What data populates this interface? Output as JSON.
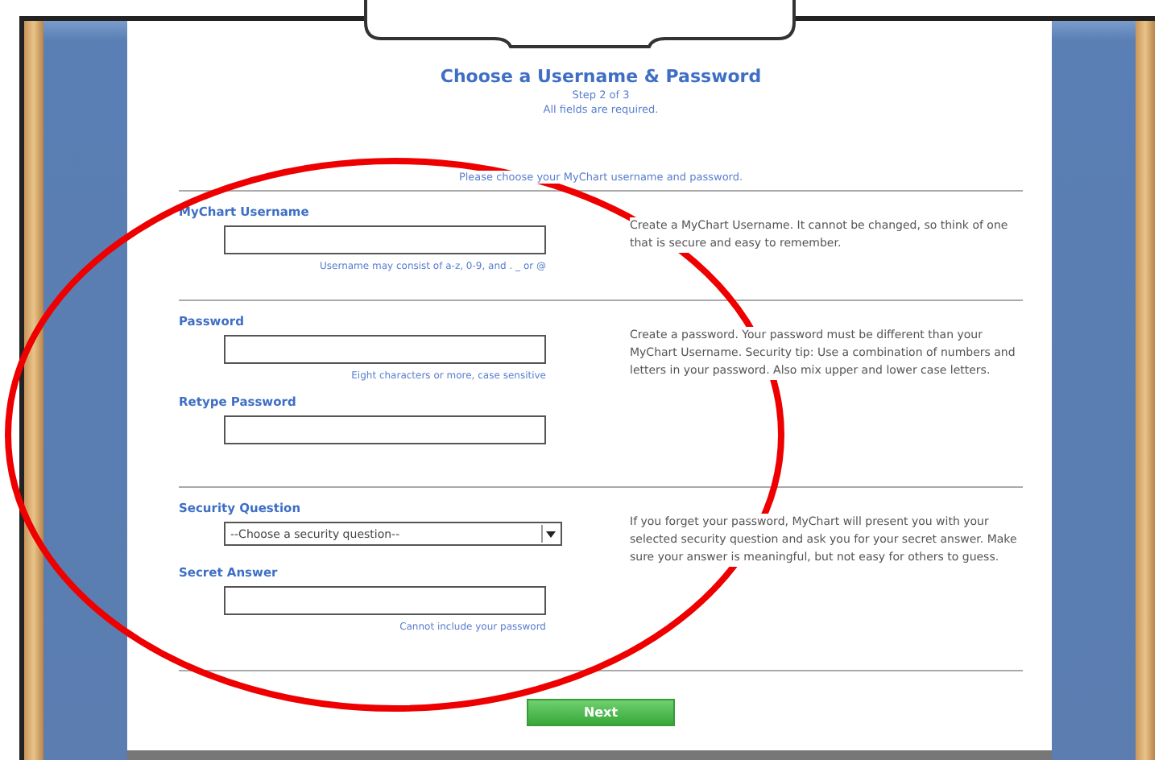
{
  "header": {
    "title": "Choose a Username & Password",
    "step": "Step 2 of 3",
    "required_note": "All fields are required."
  },
  "intro": "Please choose your MyChart username and password.",
  "sections": [
    {
      "fields": [
        {
          "label": "MyChart Username",
          "kind": "text",
          "hint": "Username may consist of a-z, 0-9, and . _ or @"
        }
      ],
      "description": "Create a MyChart Username. It cannot be changed, so think of one that is secure and easy to remember."
    },
    {
      "fields": [
        {
          "label": "Password",
          "kind": "text",
          "hint": "Eight characters or more, case sensitive"
        },
        {
          "label": "Retype Password",
          "kind": "text"
        }
      ],
      "description": "Create a password. Your password must be different than your MyChart Username. Security tip: Use a combination of numbers and letters in your password. Also mix upper and lower case letters."
    },
    {
      "fields": [
        {
          "label": "Security Question",
          "kind": "select",
          "value": "--Choose a security question--"
        },
        {
          "label": "Secret Answer",
          "kind": "text",
          "hint": "Cannot include your password"
        }
      ],
      "description": "If you forget your password, MyChart will present you with your selected security question and ask you for your secret answer. Make sure your answer is meaningful, but not easy for others to guess."
    }
  ],
  "next_button": "Next"
}
